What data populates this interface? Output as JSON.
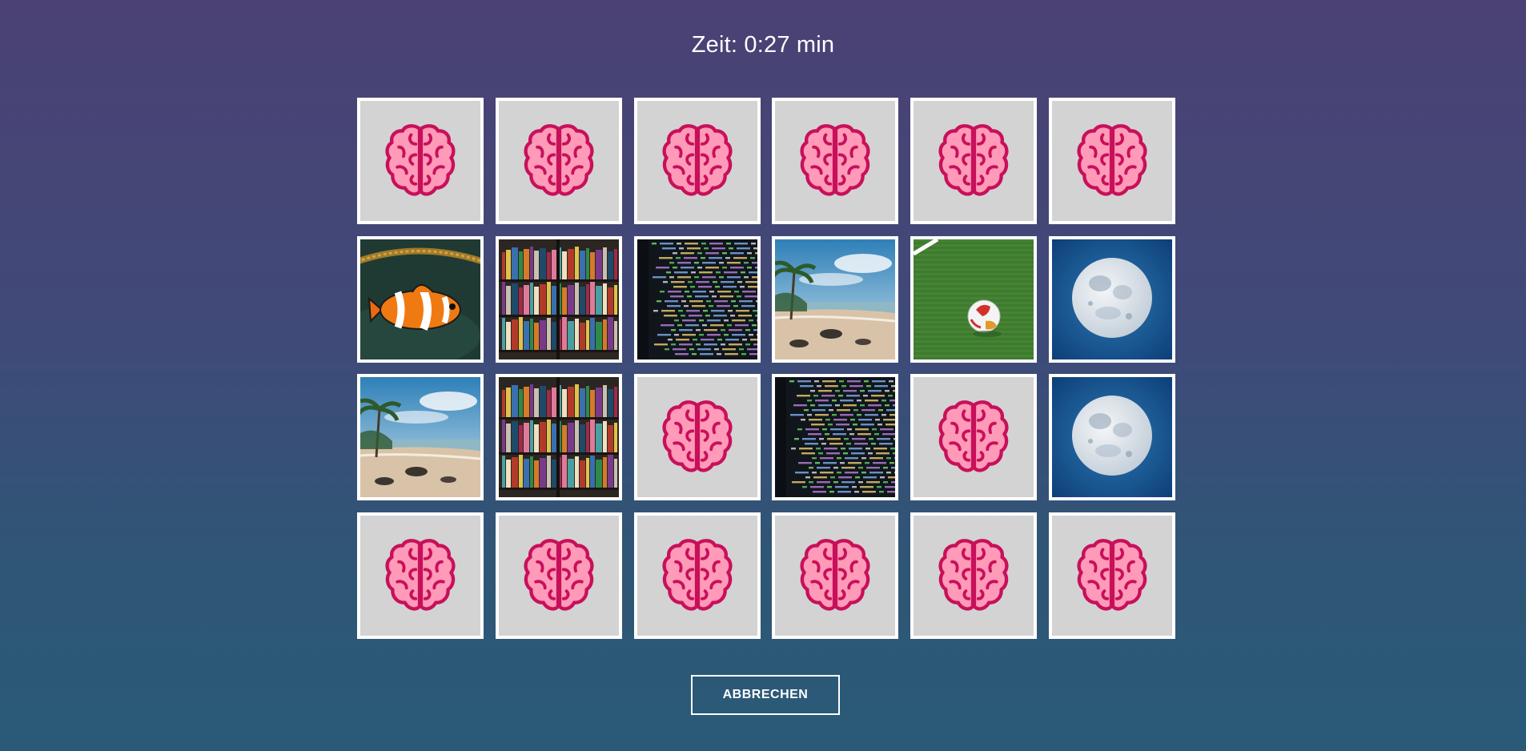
{
  "timer": {
    "text": "Zeit: 0:27 min"
  },
  "board": {
    "rows": 4,
    "columns": 6,
    "cards": [
      {
        "state": "hidden",
        "icon": "brain-icon"
      },
      {
        "state": "hidden",
        "icon": "brain-icon"
      },
      {
        "state": "hidden",
        "icon": "brain-icon"
      },
      {
        "state": "hidden",
        "icon": "brain-icon"
      },
      {
        "state": "hidden",
        "icon": "brain-icon"
      },
      {
        "state": "hidden",
        "icon": "brain-icon"
      },
      {
        "state": "revealed",
        "image": "clownfish"
      },
      {
        "state": "revealed",
        "image": "bookshelf"
      },
      {
        "state": "revealed",
        "image": "code"
      },
      {
        "state": "revealed",
        "image": "beach"
      },
      {
        "state": "revealed",
        "image": "soccer-ball"
      },
      {
        "state": "revealed",
        "image": "moon"
      },
      {
        "state": "revealed",
        "image": "beach"
      },
      {
        "state": "revealed",
        "image": "bookshelf"
      },
      {
        "state": "hidden",
        "icon": "brain-icon"
      },
      {
        "state": "revealed",
        "image": "code"
      },
      {
        "state": "hidden",
        "icon": "brain-icon"
      },
      {
        "state": "revealed",
        "image": "moon"
      },
      {
        "state": "hidden",
        "icon": "brain-icon"
      },
      {
        "state": "hidden",
        "icon": "brain-icon"
      },
      {
        "state": "hidden",
        "icon": "brain-icon"
      },
      {
        "state": "hidden",
        "icon": "brain-icon"
      },
      {
        "state": "hidden",
        "icon": "brain-icon"
      },
      {
        "state": "hidden",
        "icon": "brain-icon"
      }
    ]
  },
  "cancel_button": {
    "label": "ABBRECHEN"
  },
  "colors": {
    "card_back": "#d3d3d3",
    "card_border": "#ffffff",
    "brain_fill": "#ff9ab8",
    "brain_stroke": "#c8105a"
  }
}
